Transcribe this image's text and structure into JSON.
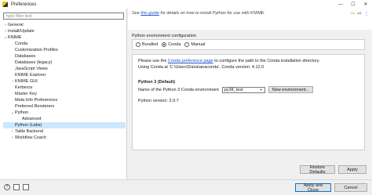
{
  "window": {
    "title": "Preferences",
    "controls": {
      "minimize": "—",
      "maximize": "☐",
      "close": "✕"
    }
  },
  "filter": {
    "placeholder": "type filter text"
  },
  "tree": [
    {
      "label": "General",
      "level": 0,
      "expander": "›"
    },
    {
      "label": "Install/Update",
      "level": 0,
      "expander": "›"
    },
    {
      "label": "KNIME",
      "level": 0,
      "expander": "⌄"
    },
    {
      "label": "Conda",
      "level": 1,
      "expander": ""
    },
    {
      "label": "Customization Profiles",
      "level": 1,
      "expander": ""
    },
    {
      "label": "Databases",
      "level": 1,
      "expander": ""
    },
    {
      "label": "Databases (legacy)",
      "level": 1,
      "expander": ""
    },
    {
      "label": "JavaScript Views",
      "level": 1,
      "expander": ""
    },
    {
      "label": "KNIME Explorer",
      "level": 1,
      "expander": ""
    },
    {
      "label": "KNIME GUI",
      "level": 1,
      "expander": "›"
    },
    {
      "label": "Kerberos",
      "level": 1,
      "expander": ""
    },
    {
      "label": "Master Key",
      "level": 1,
      "expander": ""
    },
    {
      "label": "Meta Info Preferences",
      "level": 1,
      "expander": ""
    },
    {
      "label": "Preferred Renderers",
      "level": 1,
      "expander": ""
    },
    {
      "label": "Python",
      "level": 1,
      "expander": "⌄"
    },
    {
      "label": "Advanced",
      "level": 2,
      "expander": ""
    },
    {
      "label": "Python (Labs)",
      "level": 1,
      "expander": "",
      "selected": true
    },
    {
      "label": "Table Backend",
      "level": 1,
      "expander": "›"
    },
    {
      "label": "Workflow Coach",
      "level": 1,
      "expander": "›"
    }
  ],
  "guide": {
    "prefix": "See ",
    "link": "this guide",
    "suffix": " for details on how to install Python for use with KNIME."
  },
  "nav": {
    "back_icon": "⇦",
    "forward_icon": "⇨",
    "menu_icon": "⋮"
  },
  "env_config": {
    "heading": "Python environment configuration",
    "options": [
      {
        "label": "Bundled",
        "checked": false
      },
      {
        "label": "Conda",
        "checked": true
      },
      {
        "label": "Manual",
        "checked": false
      }
    ]
  },
  "conda": {
    "info_prefix": "Please use the ",
    "info_link": "Conda preference page",
    "info_suffix": " to configure the path to the Conda installation directory.",
    "using_line": "Using Conda at 'C:\\Users\\Daria\\anaconda'. Conda version: 4.12.0",
    "python3_heading": "Python 3 (Default)",
    "env_label": "Name of the Python 3 Conda environment",
    "env_value": "py38_test",
    "new_env_button": "New environment...",
    "python_version": "Python version: 3.9.7"
  },
  "buttons": {
    "restore_defaults": "Restore Defaults",
    "apply": "Apply",
    "apply_and_close": "Apply and Close",
    "cancel": "Cancel"
  },
  "bottom_icons": {
    "help": "?"
  }
}
